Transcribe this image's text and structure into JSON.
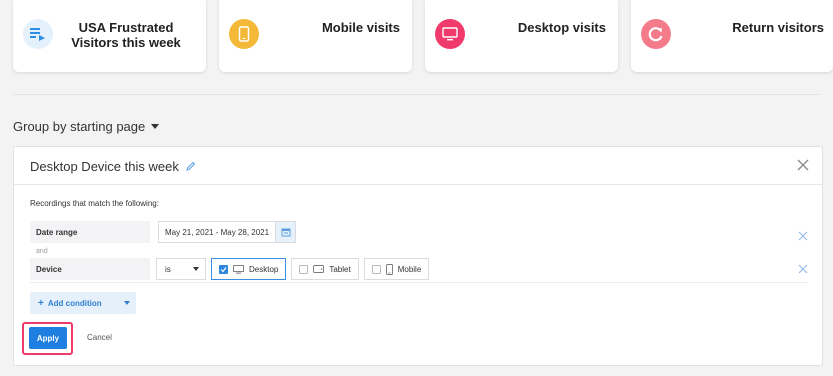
{
  "cards": [
    {
      "label": "USA Frustrated Visitors this week",
      "icon": "list-play-icon",
      "color": "#2b8fe6"
    },
    {
      "label": "Mobile visits",
      "icon": "mobile-icon",
      "color": "#f5b93a"
    },
    {
      "label": "Desktop visits",
      "icon": "desktop-icon",
      "color": "#f03a6b"
    },
    {
      "label": "Return visitors",
      "icon": "refresh-icon",
      "color": "#f47c8a"
    }
  ],
  "group_by": {
    "label": "Group by starting page"
  },
  "panel": {
    "title": "Desktop Device this week",
    "match_text": "Recordings that match the following:",
    "date_row": {
      "label": "Date range",
      "value": "May 21, 2021 - May 28, 2021"
    },
    "and_text": "and",
    "device_row": {
      "label": "Device",
      "operator": "is",
      "options": [
        {
          "label": "Desktop",
          "checked": true
        },
        {
          "label": "Tablet",
          "checked": false
        },
        {
          "label": "Mobile",
          "checked": false
        }
      ]
    },
    "add_condition": "Add condition",
    "apply": "Apply",
    "cancel": "Cancel"
  },
  "colors": {
    "accent": "#1f7fe0",
    "highlight": "#f03a6b"
  }
}
